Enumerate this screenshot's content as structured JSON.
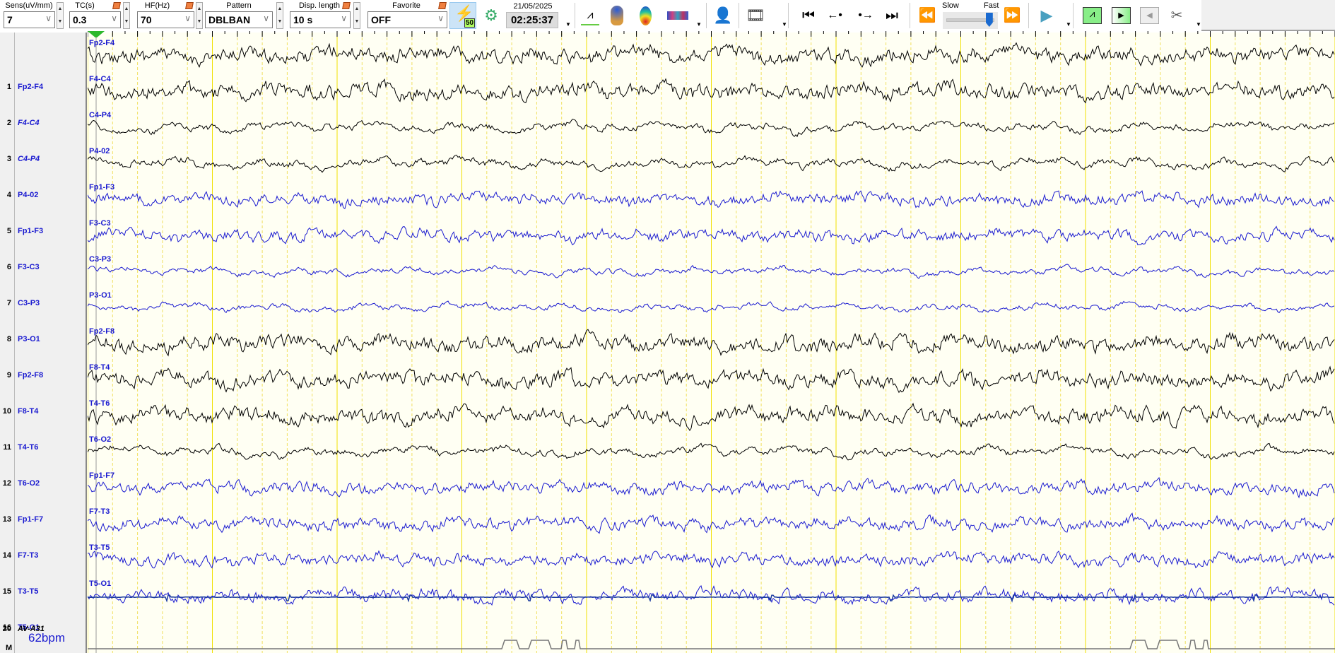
{
  "toolbar": {
    "sens": {
      "label": "Sens(uV/mm)",
      "value": "7"
    },
    "tc": {
      "label": "TC(s)",
      "value": "0.3"
    },
    "hf": {
      "label": "HF(Hz)",
      "value": "70"
    },
    "pattern": {
      "label": "Pattern",
      "value": "DBLBAN"
    },
    "disp": {
      "label": "Disp. length",
      "value": "10 s"
    },
    "favorite": {
      "label": "Favorite",
      "value": "OFF"
    },
    "filter_badge": "50",
    "date": "21/05/2025",
    "time": "02:25:37",
    "speed": {
      "slow": "Slow",
      "fast": "Fast",
      "level": 0.9
    }
  },
  "channels": [
    {
      "num": "1",
      "label": "Fp2-F4",
      "color": "#000000",
      "italic": false
    },
    {
      "num": "2",
      "label": "F4-C4",
      "color": "#000000",
      "italic": true
    },
    {
      "num": "3",
      "label": "C4-P4",
      "color": "#000000",
      "italic": true
    },
    {
      "num": "4",
      "label": "P4-02",
      "color": "#000000",
      "italic": false
    },
    {
      "num": "5",
      "label": "Fp1-F3",
      "color": "#1a1ad0",
      "italic": false
    },
    {
      "num": "6",
      "label": "F3-C3",
      "color": "#1a1ad0",
      "italic": false
    },
    {
      "num": "7",
      "label": "C3-P3",
      "color": "#1a1ad0",
      "italic": false
    },
    {
      "num": "8",
      "label": "P3-O1",
      "color": "#1a1ad0",
      "italic": false
    },
    {
      "num": "9",
      "label": "Fp2-F8",
      "color": "#000000",
      "italic": false
    },
    {
      "num": "10",
      "label": "F8-T4",
      "color": "#000000",
      "italic": false
    },
    {
      "num": "11",
      "label": "T4-T6",
      "color": "#000000",
      "italic": false
    },
    {
      "num": "12",
      "label": "T6-O2",
      "color": "#000000",
      "italic": false
    },
    {
      "num": "13",
      "label": "Fp1-F7",
      "color": "#1a1ad0",
      "italic": false
    },
    {
      "num": "14",
      "label": "F7-T3",
      "color": "#1a1ad0",
      "italic": false
    },
    {
      "num": "15",
      "label": "T3-T5",
      "color": "#1a1ad0",
      "italic": false
    },
    {
      "num": "16",
      "label": "T5-O1",
      "color": "#1a1ad0",
      "italic": false
    }
  ],
  "ecg": {
    "num": "20",
    "label": "AV-A31",
    "color": "#1a3aa0",
    "heart_rate": "62bpm"
  },
  "marker": {
    "label": "M"
  }
}
